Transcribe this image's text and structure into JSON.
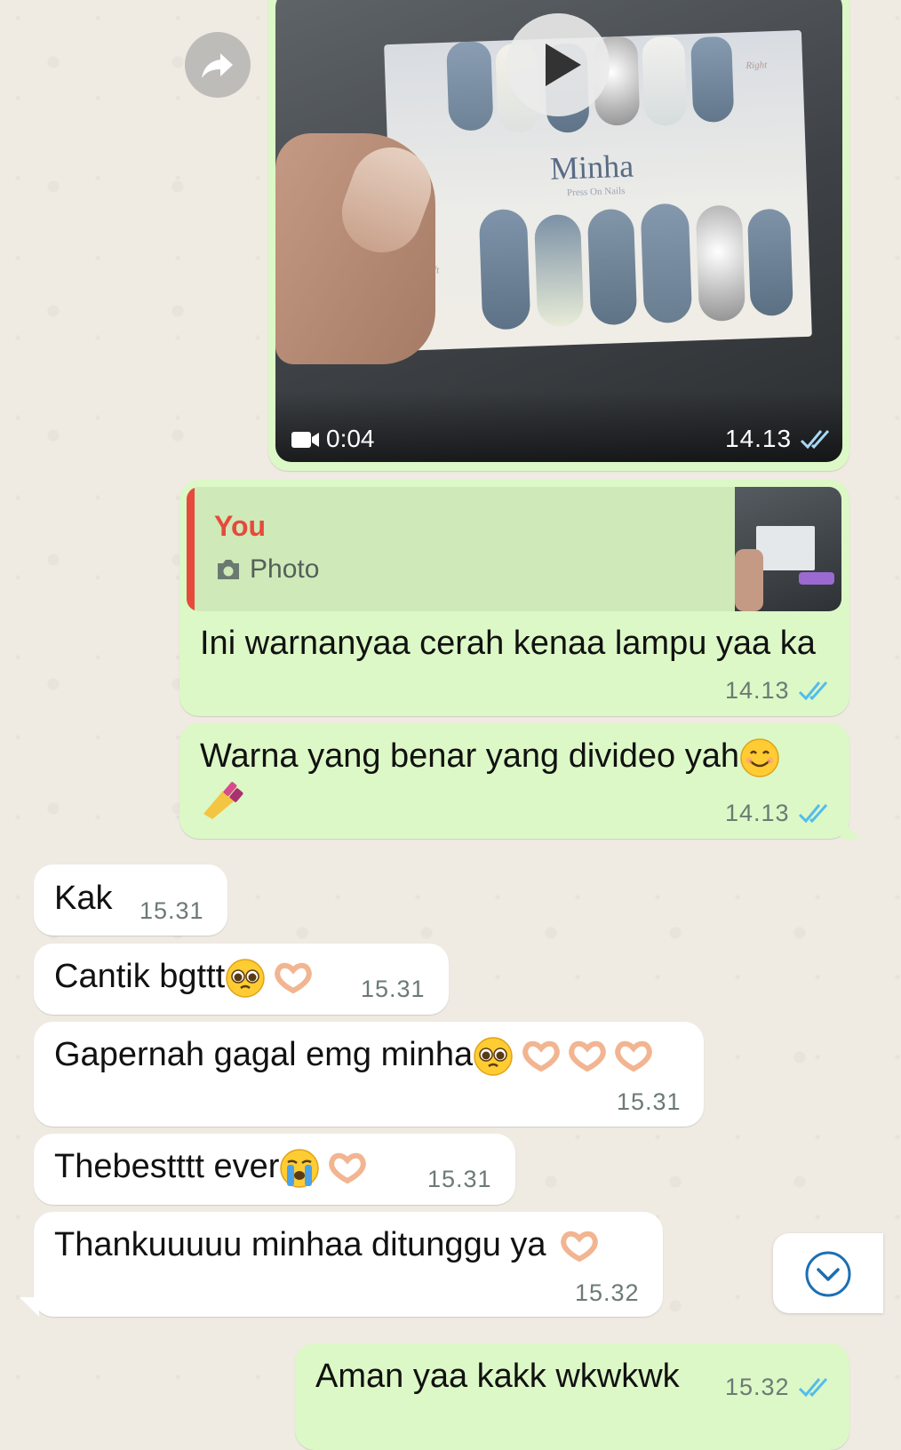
{
  "video_message": {
    "duration": "0:04",
    "time": "14.13",
    "card_brand": "Minha",
    "card_tagline": "Press On Nails",
    "card_right_label": "Right",
    "card_left_label": "Left"
  },
  "reply_message": {
    "quote_author": "You",
    "quote_type": "Photo",
    "text": "Ini warnanyaa cerah kenaa lampu yaa ka",
    "time": "14.13"
  },
  "messages": [
    {
      "direction": "out",
      "text": "Warna yang benar yang divideo yah",
      "emoji": [
        "smiling-face",
        "nail-polish"
      ],
      "time": "14.13"
    },
    {
      "direction": "in",
      "text": "Kak",
      "time": "15.31"
    },
    {
      "direction": "in",
      "text": "Cantik bgttt",
      "emoji": [
        "pleading-face",
        "heart-hands"
      ],
      "time": "15.31"
    },
    {
      "direction": "in",
      "text": "Gapernah gagal emg minha",
      "emoji": [
        "pleading-face",
        "heart-hands",
        "heart-hands",
        "heart-hands"
      ],
      "time": "15.31"
    },
    {
      "direction": "in",
      "text": "Thebestttt ever",
      "emoji": [
        "crying-face",
        "heart-hands"
      ],
      "time": "15.31"
    },
    {
      "direction": "in",
      "text": "Thankuuuuu minhaa ditunggu ya",
      "emoji": [
        "heart-hands"
      ],
      "time": "15.32"
    },
    {
      "direction": "out",
      "text": "Aman yaa kakk wkwkwk",
      "time": "15.32"
    }
  ],
  "colors": {
    "wallpaper": "#efeae2",
    "outgoing": "#dcf8c6",
    "incoming": "#ffffff",
    "read_ticks": "#53bdeb",
    "quote_author": "#e54a3b"
  }
}
